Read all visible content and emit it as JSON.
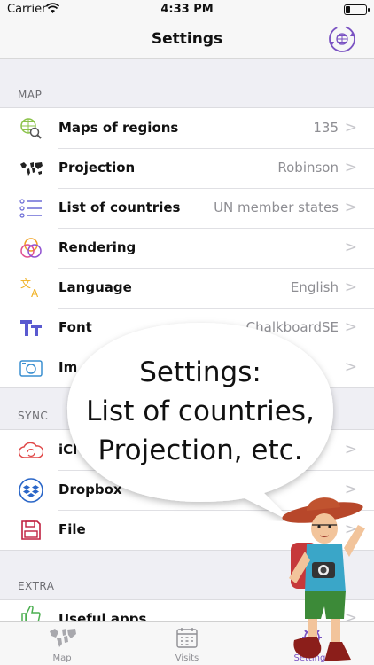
{
  "status_bar": {
    "carrier": "Carrier",
    "time": "4:33 PM"
  },
  "nav": {
    "title": "Settings",
    "sync_icon": "sync-globe-icon"
  },
  "sections": {
    "map": {
      "header": "MAP",
      "rows": [
        {
          "label": "Maps of regions",
          "value": "135",
          "icon": "globe-search-icon"
        },
        {
          "label": "Projection",
          "value": "Robinson",
          "icon": "world-map-icon"
        },
        {
          "label": "List of countries",
          "value": "UN member states",
          "icon": "list-icon"
        },
        {
          "label": "Rendering",
          "value": "",
          "icon": "color-circles-icon"
        },
        {
          "label": "Language",
          "value": "English",
          "icon": "translate-icon"
        },
        {
          "label": "Font",
          "value": "ChalkboardSE",
          "icon": "font-icon"
        },
        {
          "label": "Im",
          "value": "",
          "icon": "camera-icon"
        }
      ]
    },
    "sync": {
      "header": "SYNC",
      "rows": [
        {
          "label": "iCl",
          "value": "",
          "icon": "icloud-icon"
        },
        {
          "label": "Dropbox",
          "value": "",
          "icon": "dropbox-icon"
        },
        {
          "label": "File",
          "value": "",
          "icon": "floppy-disk-icon"
        }
      ]
    },
    "extra": {
      "header": "EXTRA",
      "rows": [
        {
          "label": "Useful apps",
          "value": "",
          "icon": "thumbs-up-icon"
        }
      ]
    }
  },
  "bubble": {
    "line1": "Settings:",
    "line2": "List of countries,",
    "line3": "Projection, etc."
  },
  "tabs": [
    {
      "label": "Map",
      "icon": "world-map-icon",
      "active": false
    },
    {
      "label": "Visits",
      "icon": "calendar-icon",
      "active": false
    },
    {
      "label": "Settings",
      "icon": "gear-icon",
      "active": true
    }
  ],
  "colors": {
    "accent": "#7a52c2",
    "chevron": "#c7c7cc",
    "value_text": "#8e8e93"
  }
}
